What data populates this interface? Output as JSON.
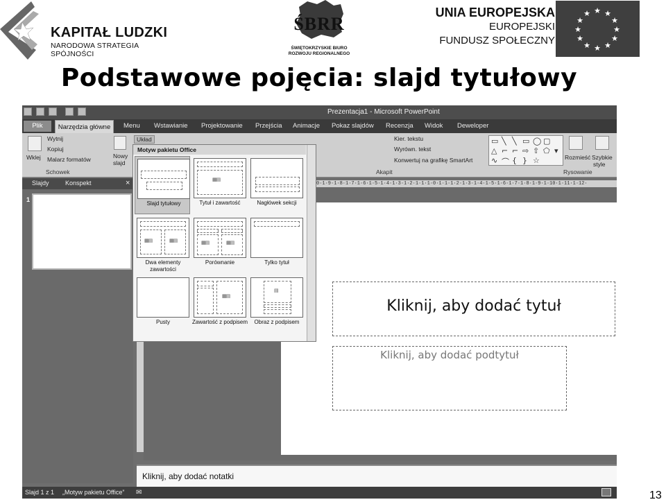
{
  "header": {
    "kapital_ludzki": {
      "title": "KAPITAŁ LUDZKI",
      "subtitle": "NARODOWA STRATEGIA SPÓJNOŚCI"
    },
    "sbrr": {
      "name": "ŚBRR",
      "caption_line1": "ŚWIĘTOKRZYSKIE BIURO",
      "caption_line2": "ROZWOJU REGIONALNEGO"
    },
    "eu": {
      "line1": "UNIA EUROPEJSKA",
      "line2": "EUROPEJSKI",
      "line3": "FUNDUSZ SPOŁECZNY"
    }
  },
  "slide_title": "Podstawowe pojęcia: slajd tytułowy",
  "page_number": "13",
  "powerpoint": {
    "window_title": "Prezentacja1 - Microsoft PowerPoint",
    "tabs": {
      "file": "Plik",
      "active": "Narzędzia główne",
      "others": [
        "Menu",
        "Wstawianie",
        "Projektowanie",
        "Przejścia",
        "Animacje",
        "Pokaz slajdów",
        "Recenzja",
        "Widok",
        "Deweloper"
      ]
    },
    "ribbon": {
      "paste": "Wklej",
      "cut": "Wytnij",
      "copy": "Kopiuj",
      "format_painter": "Malarz formatów",
      "clipboard_group": "Schowek",
      "new_slide_1": "Nowy",
      "new_slide_2": "slajd",
      "layout": "Układ",
      "text_direction": "Kier. tekstu",
      "align_text": "Wyrówn. tekst",
      "smartart": "Konwertuj na grafikę SmartArt",
      "paragraph_group": "Akapit",
      "arrange": "Rozmieść",
      "quick_styles_1": "Szybkie",
      "quick_styles_2": "style",
      "drawing_group": "Rysowanie"
    },
    "pane": {
      "tab_slides": "Slajdy",
      "tab_outline": "Konspekt",
      "close": "×",
      "slide_number": "1"
    },
    "layout_gallery": {
      "header": "Motyw pakietu Office",
      "layouts": [
        "Slajd tytułowy",
        "Tytuł i zawartość",
        "Nagłówek sekcji",
        "Dwa elementy zawartości",
        "Porównanie",
        "Tylko tytuł",
        "Pusty",
        "Zawartość z podpisem",
        "Obraz z podpisem"
      ]
    },
    "ruler_text": "0·1·9·1·8·1·7·1·6·1·5·1·4·1·3·1·2·1·1·1·0·1·1·1·2·1·3·1·4·1·5·1·6·1·7·1·8·1·9·1·10·1·11·1·12·",
    "slide": {
      "title_placeholder": "Kliknij, aby dodać tytuł",
      "subtitle_placeholder": "Kliknij, aby dodać podtytuł"
    },
    "notes_placeholder": "Kliknij, aby dodać notatki",
    "status": {
      "slide_info": "Slajd 1 z 1",
      "theme": "„Motyw pakietu Office”"
    }
  }
}
